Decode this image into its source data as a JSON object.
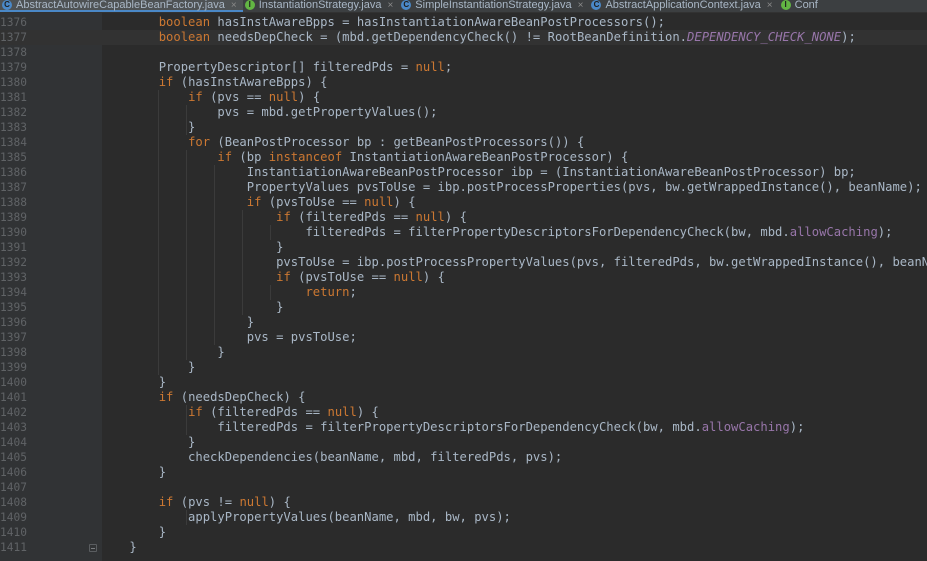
{
  "tabs": [
    {
      "label": "AbstractAutowireCapableBeanFactory.java",
      "badge": "C",
      "color": "#4a88c7",
      "active": true
    },
    {
      "label": "InstantiationStrategy.java",
      "badge": "I",
      "color": "#62b543",
      "active": false
    },
    {
      "label": "SimpleInstantiationStrategy.java",
      "badge": "C",
      "color": "#4a88c7",
      "active": false
    },
    {
      "label": "AbstractApplicationContext.java",
      "badge": "C",
      "color": "#4a88c7",
      "active": false
    },
    {
      "label": "Conf",
      "badge": "I",
      "color": "#62b543",
      "active": false
    }
  ],
  "lines": [
    {
      "n": "1376",
      "tokens": [
        [
          "        ",
          ""
        ],
        [
          "boolean",
          "kw"
        ],
        [
          " hasInstAwareBpps = hasInstantiationAwareBeanPostProcessors();",
          ""
        ]
      ]
    },
    {
      "n": "1377",
      "current": true,
      "tokens": [
        [
          "        ",
          ""
        ],
        [
          "boolean",
          "kw"
        ],
        [
          " needsDepCheck = (mbd.getDependencyCheck() != RootBeanDefinition.",
          ""
        ],
        [
          "DEPENDENCY_CHECK_NONE",
          "cst"
        ],
        [
          ");",
          ""
        ]
      ]
    },
    {
      "n": "1378",
      "tokens": []
    },
    {
      "n": "1379",
      "tokens": [
        [
          "        PropertyDescriptor[] filteredPds = ",
          ""
        ],
        [
          "null",
          "kw"
        ],
        [
          ";",
          ""
        ]
      ]
    },
    {
      "n": "1380",
      "tokens": [
        [
          "        ",
          ""
        ],
        [
          "if",
          "kw"
        ],
        [
          " (hasInstAwareBpps) {",
          ""
        ]
      ]
    },
    {
      "n": "1381",
      "tokens": [
        [
          "            ",
          ""
        ],
        [
          "if",
          "kw"
        ],
        [
          " (pvs == ",
          ""
        ],
        [
          "null",
          "kw"
        ],
        [
          ") {",
          ""
        ]
      ]
    },
    {
      "n": "1382",
      "tokens": [
        [
          "                pvs = mbd.getPropertyValues();",
          ""
        ]
      ]
    },
    {
      "n": "1383",
      "tokens": [
        [
          "            }",
          ""
        ]
      ]
    },
    {
      "n": "1384",
      "tokens": [
        [
          "            ",
          ""
        ],
        [
          "for",
          "kw"
        ],
        [
          " (BeanPostProcessor bp : getBeanPostProcessors()) {",
          ""
        ]
      ]
    },
    {
      "n": "1385",
      "tokens": [
        [
          "                ",
          ""
        ],
        [
          "if",
          "kw"
        ],
        [
          " (bp ",
          ""
        ],
        [
          "instanceof",
          "kw"
        ],
        [
          " InstantiationAwareBeanPostProcessor) {",
          ""
        ]
      ]
    },
    {
      "n": "1386",
      "tokens": [
        [
          "                    InstantiationAwareBeanPostProcessor ibp = (InstantiationAwareBeanPostProcessor) bp;",
          ""
        ]
      ]
    },
    {
      "n": "1387",
      "tokens": [
        [
          "                    PropertyValues pvsToUse = ibp.postProcessProperties(pvs, bw.getWrappedInstance(), beanName);",
          ""
        ]
      ]
    },
    {
      "n": "1388",
      "tokens": [
        [
          "                    ",
          ""
        ],
        [
          "if",
          "kw"
        ],
        [
          " (pvsToUse == ",
          ""
        ],
        [
          "null",
          "kw"
        ],
        [
          ") {",
          ""
        ]
      ]
    },
    {
      "n": "1389",
      "tokens": [
        [
          "                        ",
          ""
        ],
        [
          "if",
          "kw"
        ],
        [
          " (filteredPds == ",
          ""
        ],
        [
          "null",
          "kw"
        ],
        [
          ") {",
          ""
        ]
      ]
    },
    {
      "n": "1390",
      "tokens": [
        [
          "                            filteredPds = filterPropertyDescriptorsForDependencyCheck(bw, mbd.",
          ""
        ],
        [
          "allowCaching",
          "fld"
        ],
        [
          ");",
          ""
        ]
      ]
    },
    {
      "n": "1391",
      "tokens": [
        [
          "                        }",
          ""
        ]
      ]
    },
    {
      "n": "1392",
      "tokens": [
        [
          "                        pvsToUse = ibp.postProcessPropertyValues(pvs, filteredPds, bw.getWrappedInstance(), beanName);",
          ""
        ]
      ]
    },
    {
      "n": "1393",
      "tokens": [
        [
          "                        ",
          ""
        ],
        [
          "if",
          "kw"
        ],
        [
          " (pvsToUse == ",
          ""
        ],
        [
          "null",
          "kw"
        ],
        [
          ") {",
          ""
        ]
      ]
    },
    {
      "n": "1394",
      "tokens": [
        [
          "                            ",
          ""
        ],
        [
          "return",
          "kw"
        ],
        [
          ";",
          ""
        ]
      ]
    },
    {
      "n": "1395",
      "tokens": [
        [
          "                        }",
          ""
        ]
      ]
    },
    {
      "n": "1396",
      "tokens": [
        [
          "                    }",
          ""
        ]
      ]
    },
    {
      "n": "1397",
      "tokens": [
        [
          "                    pvs = pvsToUse;",
          ""
        ]
      ]
    },
    {
      "n": "1398",
      "tokens": [
        [
          "                }",
          ""
        ]
      ]
    },
    {
      "n": "1399",
      "tokens": [
        [
          "            }",
          ""
        ]
      ]
    },
    {
      "n": "1400",
      "tokens": [
        [
          "        }",
          ""
        ]
      ]
    },
    {
      "n": "1401",
      "tokens": [
        [
          "        ",
          ""
        ],
        [
          "if",
          "kw"
        ],
        [
          " (needsDepCheck) {",
          ""
        ]
      ]
    },
    {
      "n": "1402",
      "tokens": [
        [
          "            ",
          ""
        ],
        [
          "if",
          "kw"
        ],
        [
          " (filteredPds == ",
          ""
        ],
        [
          "null",
          "kw"
        ],
        [
          ") {",
          ""
        ]
      ]
    },
    {
      "n": "1403",
      "tokens": [
        [
          "                filteredPds = filterPropertyDescriptorsForDependencyCheck(bw, mbd.",
          ""
        ],
        [
          "allowCaching",
          "fld"
        ],
        [
          ");",
          ""
        ]
      ]
    },
    {
      "n": "1404",
      "tokens": [
        [
          "            }",
          ""
        ]
      ]
    },
    {
      "n": "1405",
      "tokens": [
        [
          "            checkDependencies(beanName, mbd, filteredPds, pvs);",
          ""
        ]
      ]
    },
    {
      "n": "1406",
      "tokens": [
        [
          "        }",
          ""
        ]
      ]
    },
    {
      "n": "1407",
      "tokens": []
    },
    {
      "n": "1408",
      "tokens": [
        [
          "        ",
          ""
        ],
        [
          "if",
          "kw"
        ],
        [
          " (pvs != ",
          ""
        ],
        [
          "null",
          "kw"
        ],
        [
          ") {",
          ""
        ]
      ]
    },
    {
      "n": "1409",
      "tokens": [
        [
          "            applyPropertyValues(beanName, mbd, bw, pvs);",
          ""
        ]
      ]
    },
    {
      "n": "1410",
      "tokens": [
        [
          "        }",
          ""
        ]
      ]
    },
    {
      "n": "1411",
      "fold": true,
      "tokens": [
        [
          "    }",
          ""
        ]
      ]
    }
  ]
}
